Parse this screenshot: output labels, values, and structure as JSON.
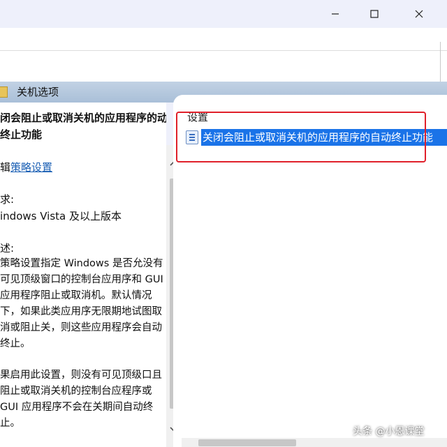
{
  "window": {
    "minimize_glyph": "—",
    "maximize_glyph": "☐",
    "close_glyph": "✕"
  },
  "header": {
    "title": "关机选项"
  },
  "description": {
    "title": "闭会阻止或取消关机的应用程序的动终止功能",
    "edit_prefix": "辑",
    "edit_link": "策略设置",
    "requirements_label": "求:",
    "requirements_value": "indows Vista 及以上版本",
    "description_label": "述:",
    "paragraph1": "策略设置指定 Windows 是否允没有可见顶级窗口的控制台应用序和 GUI 应用程序阻止或取消机。默认情况下，如果此类应用序无限期地试图取消或阻止关，则这些应用程序会自动终止。",
    "paragraph2": "果启用此设置，则没有可见顶级口且阻止或取消关机的控制台应程序或 GUI 应用程序不会在关期间自动终止。"
  },
  "settings": {
    "column_header": "设置",
    "selected_item": "关闭会阻止或取消关机的应用程序的自动终止功能"
  },
  "watermark": {
    "text": "头条 @小恩课堂"
  },
  "colors": {
    "selection": "#1a73e8",
    "highlight_box": "#e0202a",
    "link": "#1a5fb4"
  }
}
